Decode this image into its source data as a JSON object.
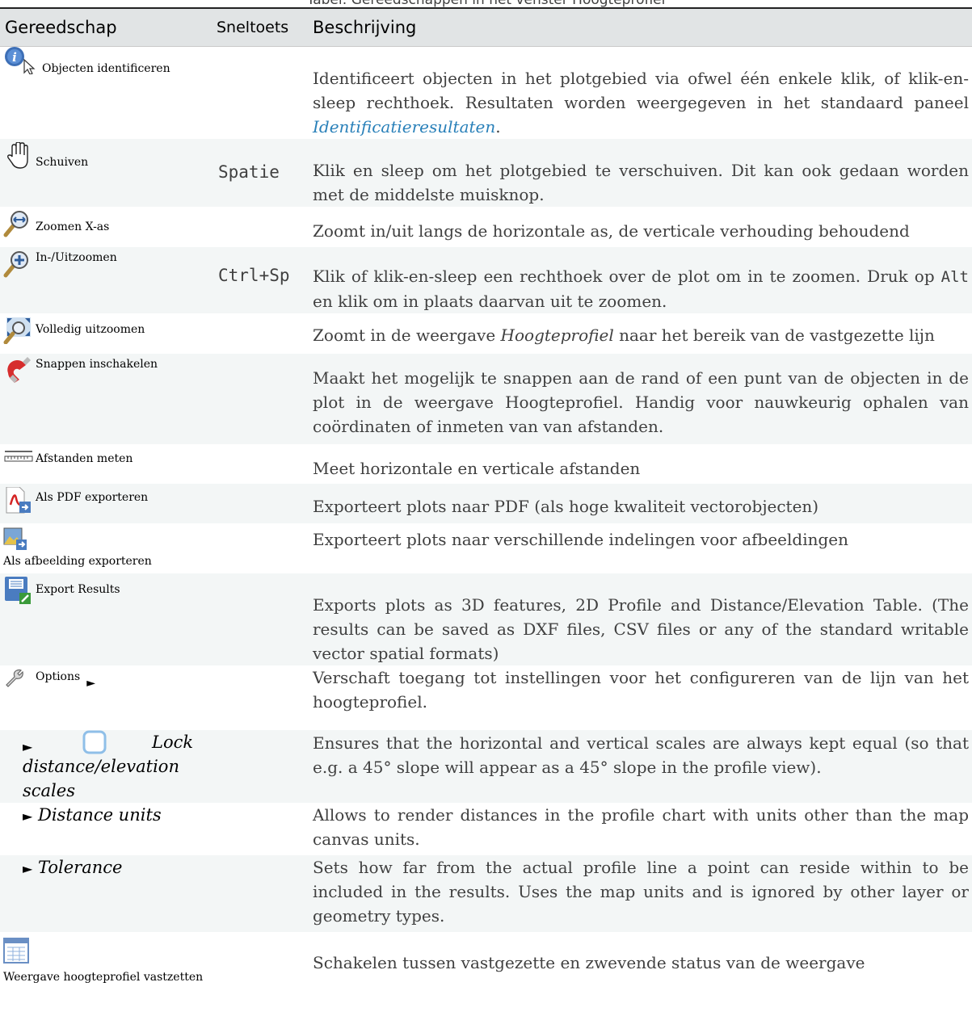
{
  "caption": "Tabel: Gereedschappen in het venster Hoogteprofiel",
  "headers": {
    "tool": "Gereedschap",
    "shortcut": "Sneltoets",
    "description": "Beschrijving"
  },
  "rows": [
    {
      "tool": "Objecten identificeren",
      "icon": "identify-icon",
      "shortcut": "",
      "desc_pre": "Identificeert objecten in het plotgebied via ofwel één enkele klik, of klik-en-sleep rechthoek. Resultaten worden weergegeven in het standaard paneel ",
      "desc_link": "Identificatieresultaten",
      "desc_post": "."
    },
    {
      "tool": "Schuiven",
      "icon": "pan-hand-icon",
      "shortcut": "Spatie",
      "desc": "Klik en sleep om het plotgebied te verschuiven. Dit kan ook gedaan worden met de middelste muisknop."
    },
    {
      "tool": "Zoomen X-as",
      "icon": "zoom-x-axis-icon",
      "shortcut": "",
      "desc": "Zoomt in/uit langs de horizontale as, de verticale verhouding behoudend"
    },
    {
      "tool": "In-/Uitzoomen",
      "icon": "zoom-in-icon",
      "shortcut": "Ctrl+Sp",
      "desc_pre": "Klik of klik-en-sleep een rechthoek over de plot om in te zoomen. Druk op ",
      "desc_code": "Alt",
      "desc_post": " en klik om in plaats daarvan uit te zoomen."
    },
    {
      "tool": "Volledig uitzoomen",
      "icon": "zoom-full-icon",
      "shortcut": "",
      "desc_pre": "Zoomt in de weergave ",
      "desc_em": "Hoogteprofiel",
      "desc_post": " naar het bereik van de vastgezette lijn"
    },
    {
      "tool": "Snappen inschakelen",
      "icon": "snapping-magnet-icon",
      "shortcut": "",
      "desc": "Maakt het mogelijk te snappen aan de rand of een punt van de objecten in de plot in de weergave Hoogteprofiel. Handig voor nauwkeurig ophalen van coördinaten of inmeten van van afstanden."
    },
    {
      "tool": "Afstanden meten",
      "icon": "measure-ruler-icon",
      "shortcut": "",
      "desc": "Meet horizontale en verticale afstanden"
    },
    {
      "tool": "Als PDF exporteren",
      "icon": "pdf-export-icon",
      "shortcut": "",
      "desc": "Exporteert plots naar PDF (als hoge kwaliteit vectorobjecten)"
    },
    {
      "tool": "Als afbeelding exporteren",
      "icon": "image-export-icon",
      "shortcut": "",
      "desc": "Exporteert plots naar verschillende indelingen voor afbeeldingen"
    },
    {
      "tool": "Export Results",
      "icon": "export-results-icon",
      "shortcut": "",
      "desc": "Exports plots as 3D features, 2D Profile and Distance/Elevation Table. (The results can be saved as DXF files, CSV files or any of the standard writable vector spatial formats)"
    },
    {
      "tool": "Options",
      "icon": "wrench-icon",
      "shortcut": "",
      "desc": "Verschaft toegang tot instellingen voor het configureren van de lijn van het hoogteprofiel."
    },
    {
      "tool": "Lock distance/elevation scales",
      "icon": "checkbox-icon",
      "shortcut": "",
      "desc": "Ensures that the horizontal and vertical scales are always kept equal (so that e.g. a 45° slope will appear as a 45° slope in the profile view)."
    },
    {
      "tool": "Distance units",
      "shortcut": "",
      "desc": "Allows to render distances in the profile chart with units other than the map canvas units."
    },
    {
      "tool": "Tolerance",
      "shortcut": "",
      "desc": "Sets how far from the actual profile line a point can reside within to be included in the results. Uses the map units and is ignored by other layer or geometry types."
    },
    {
      "tool": "Weergave hoogteprofiel vastzetten",
      "icon": "dock-window-icon",
      "shortcut": "",
      "desc": "Schakelen tussen vastgezette en zwevende status van de weergave"
    }
  ],
  "arrow_glyph": "►",
  "colors": {
    "header_bg": "#e1e4e5",
    "stripe_bg": "#f3f6f6",
    "link": "#2980b9",
    "text": "#404040"
  }
}
